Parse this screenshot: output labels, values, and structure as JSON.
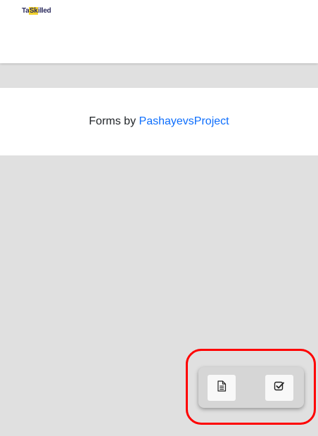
{
  "header": {
    "logo": {
      "text_before": "Ta",
      "text_highlight": "Sk",
      "text_after": "illed"
    }
  },
  "footer": {
    "prefix": "Forms by ",
    "link_label": "PashayevsProject",
    "link_color": "#0d6efd"
  },
  "floating_panel": {
    "buttons": [
      {
        "icon": "document-icon"
      },
      {
        "icon": "checkbox-icon"
      }
    ]
  },
  "colors": {
    "page_bg": "#e0e0e0",
    "highlight": "#ff0000",
    "logo_accent": "#f2d22e",
    "logo_text": "#2c2c5e"
  }
}
